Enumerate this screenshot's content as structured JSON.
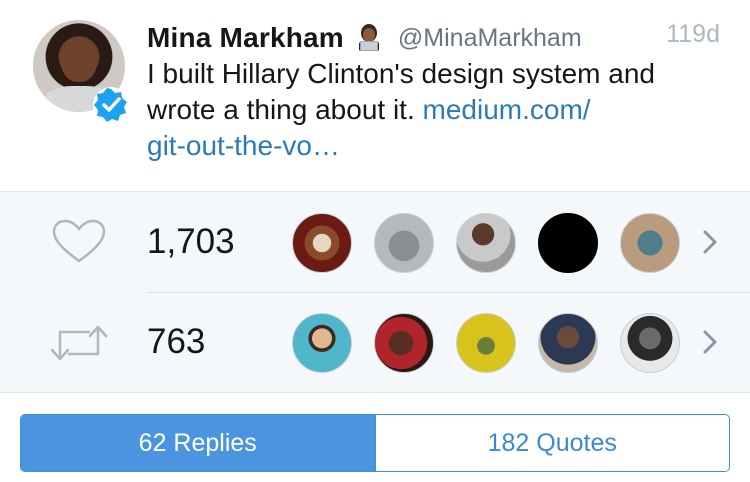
{
  "tweet": {
    "display_name": "Mina Markham",
    "handle": "@MinaMarkham",
    "timestamp": "119d",
    "text": "I built Hillary Clinton's design system and wrote a thing about it.",
    "link_line1": "medium.com/",
    "link_line2": "git-out-the-vo…"
  },
  "stats": {
    "likes": {
      "count": "1,703",
      "icon": "heart-icon",
      "avatars": [
        "latte-art-avatar",
        "gray-cat-avatar",
        "woman-portrait-avatar",
        "black-avatar",
        "scooter-avatar"
      ]
    },
    "retweets": {
      "count": "763",
      "icon": "retweet-icon",
      "avatars": [
        "illustrated-man-avatar",
        "two-women-avatar",
        "yellow-photo-avatar",
        "man-portrait-avatar",
        "bw-man-avatar"
      ]
    }
  },
  "tabs": [
    {
      "label": "62 Replies",
      "active": true
    },
    {
      "label": "182 Quotes",
      "active": false
    }
  ],
  "colors": {
    "accent": "#4a94e0",
    "link": "#2b7bb9",
    "verified": "#1da1f2",
    "stats_background": "#f5f8fa"
  }
}
